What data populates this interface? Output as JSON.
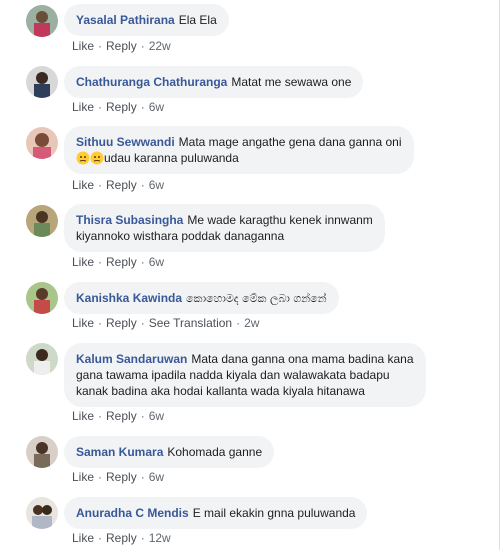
{
  "comments": [
    {
      "author": "Yasalal Pathirana",
      "text": "Ela Ela",
      "time": "22w",
      "like": "Like",
      "reply": "Reply",
      "avatar": "avatar-photo"
    },
    {
      "author": "Chathuranga Chathuranga",
      "text": "Matat me sewawa one",
      "time": "6w",
      "like": "Like",
      "reply": "Reply",
      "avatar": "avatar-photo"
    },
    {
      "author": "Sithuu Sewwandi",
      "text": "Mata mage angathe gena dana ganna oni",
      "text2": "udau karanna puluwanda",
      "emoji": "thinking-face-emoji",
      "time": "6w",
      "like": "Like",
      "reply": "Reply",
      "avatar": "avatar-photo"
    },
    {
      "author": "Thisra Subasingha",
      "text": "Me wade karagthu kenek innwanm",
      "text2": "kiyannoko wisthara poddak danaganna",
      "time": "6w",
      "like": "Like",
      "reply": "Reply",
      "avatar": "avatar-photo"
    },
    {
      "author": "Kanishka Kawinda",
      "text": "කොහොමද මේක ලබා ගන්නේ",
      "time": "2w",
      "like": "Like",
      "reply": "Reply",
      "see_translation": "See Translation",
      "avatar": "avatar-photo"
    },
    {
      "author": "Kalum Sandaruwan",
      "text": "Mata dana ganna ona mama badina kana",
      "text2": "gana tawama ipadila nadda kiyala dan walawakata badapu",
      "text3": "kanak badina aka hodai kallanta wada kiyala hitanawa",
      "time": "6w",
      "like": "Like",
      "reply": "Reply",
      "avatar": "avatar-photo"
    },
    {
      "author": "Saman Kumara",
      "text": "Kohomada ganne",
      "time": "6w",
      "like": "Like",
      "reply": "Reply",
      "avatar": "avatar-photo"
    },
    {
      "author": "Anuradha C Mendis",
      "text": "E mail ekakin gnna puluwanda",
      "time": "12w",
      "like": "Like",
      "reply": "Reply",
      "avatar": "avatar-photo"
    }
  ],
  "separator": "·",
  "colors": {
    "author": "#385898",
    "bubble": "#f2f3f5",
    "meta": "#606770"
  }
}
